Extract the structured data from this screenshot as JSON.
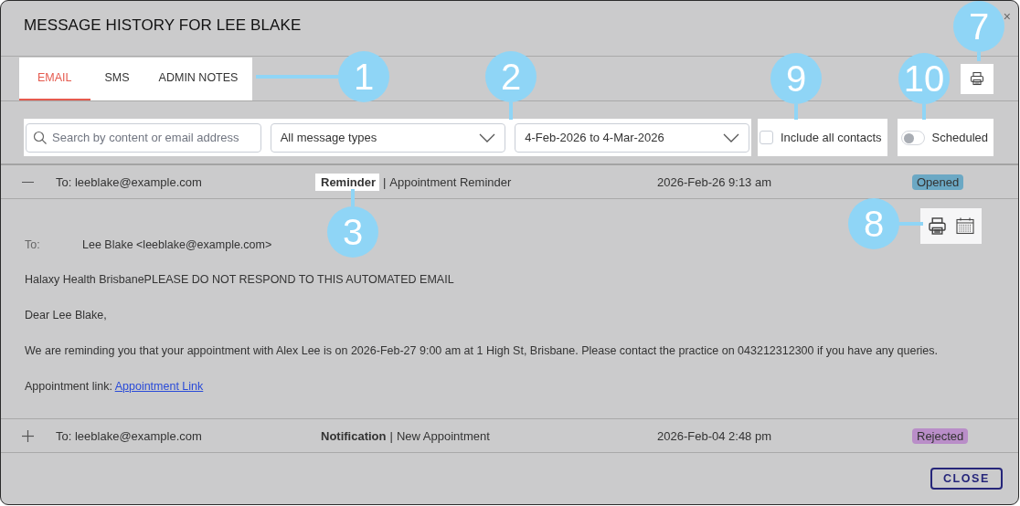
{
  "dialog": {
    "title": "MESSAGE HISTORY FOR LEE BLAKE",
    "close_glyph": "×"
  },
  "tabs": [
    {
      "label": "EMAIL",
      "selected": true
    },
    {
      "label": "SMS",
      "selected": false
    },
    {
      "label": "ADMIN NOTES",
      "selected": false
    }
  ],
  "filters": {
    "search": {
      "placeholder": "Search by content or email address"
    },
    "message_type": {
      "value": "All message types"
    },
    "date_range": {
      "value": "4-Feb-2026 to 4-Mar-2026"
    },
    "include_all_contacts": {
      "label": "Include all contacts",
      "checked": false
    },
    "scheduled": {
      "label": "Scheduled",
      "on": false
    }
  },
  "messages": [
    {
      "expanded": true,
      "to": "To: leeblake@example.com",
      "type": "Reminder",
      "type_highlighted": true,
      "separator": "|",
      "subject": "Appointment Reminder",
      "date": "2026-Feb-26 9:13 am",
      "status": "Opened",
      "color": "#6ba8c4"
    },
    {
      "expanded": false,
      "to": "To: leeblake@example.com",
      "type": "Notification",
      "type_highlighted": false,
      "separator": "|",
      "subject": "New Appointment",
      "date": "2026-Feb-04 2:48 pm",
      "status": "Rejected",
      "color": "#b98ec8"
    }
  ],
  "open_message": {
    "to_label": "To:",
    "to_value": "Lee Blake <leeblake@example.com>",
    "paragraphs": [
      "Halaxy Health BrisbanePLEASE DO NOT RESPOND TO THIS AUTOMATED EMAIL",
      "Dear Lee Blake,",
      "We are reminding you that your appointment with Alex Lee is on 2026-Feb-27 9:00 am at 1 High St, Brisbane. Please contact the practice on 043212312300 if you have any queries."
    ],
    "link_label": "Appointment link:",
    "link_text": "Appointment Link"
  },
  "close_button": "CLOSE",
  "callouts": [
    {
      "number": "1",
      "kind": "left"
    },
    {
      "number": "2",
      "kind": "down"
    },
    {
      "number": "9",
      "kind": "down"
    },
    {
      "number": "10",
      "kind": "down"
    },
    {
      "number": "7",
      "kind": "down"
    },
    {
      "number": "3",
      "kind": "up"
    },
    {
      "number": "8",
      "kind": "right"
    }
  ]
}
